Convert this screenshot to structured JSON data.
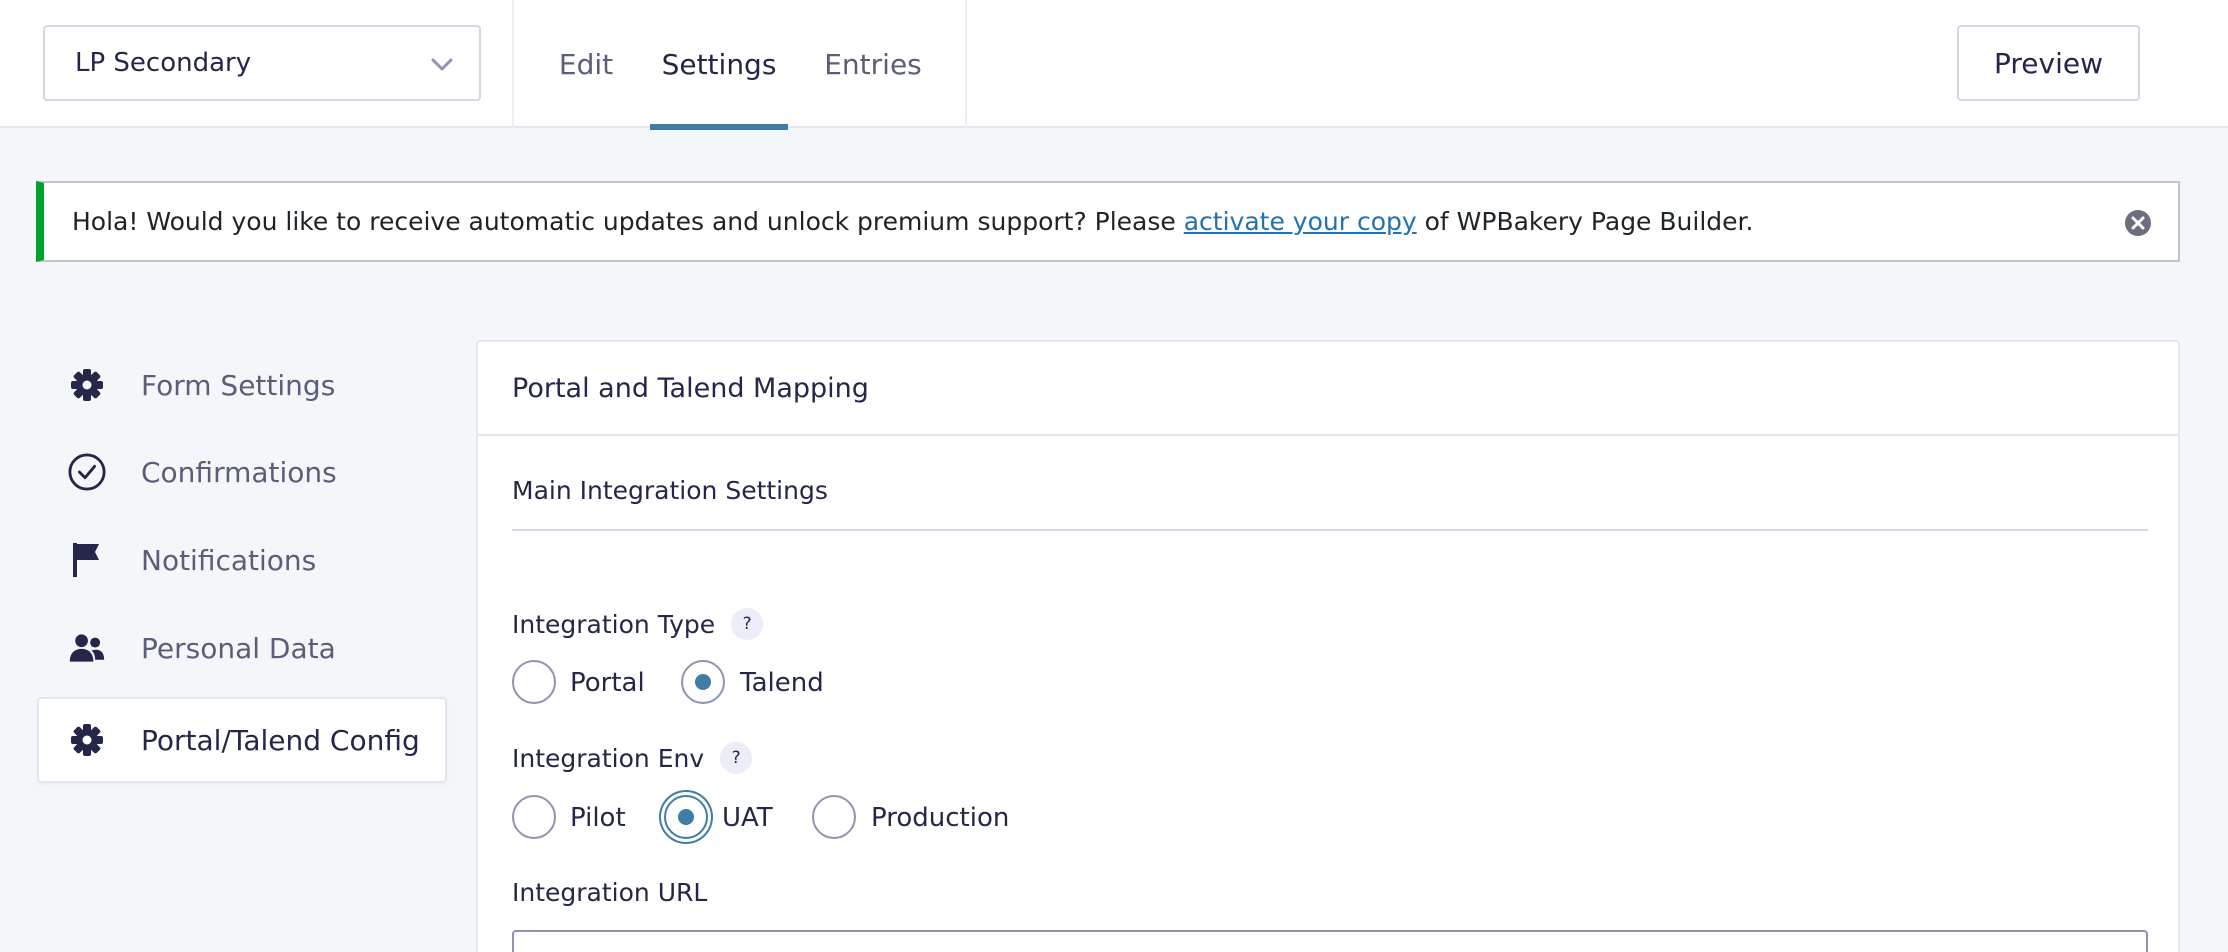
{
  "header": {
    "form_selector": {
      "value": "LP Secondary",
      "icon": "chevron-down-icon"
    },
    "tabs": [
      {
        "label": "Edit",
        "active": false
      },
      {
        "label": "Settings",
        "active": true
      },
      {
        "label": "Entries",
        "active": false
      }
    ],
    "preview_label": "Preview",
    "accent_color": "#3e7da6"
  },
  "notice": {
    "text_before": "Hola! Would you like to receive automatic updates and unlock premium support? Please ",
    "link_text": "activate your copy",
    "text_after": " of WPBakery Page Builder.",
    "border_color": "#00a32a",
    "dismiss_icon": "close-circle-icon"
  },
  "sidebar": {
    "items": [
      {
        "label": "Form Settings",
        "icon": "gear-icon",
        "active": false
      },
      {
        "label": "Confirmations",
        "icon": "check-circle-icon",
        "active": false
      },
      {
        "label": "Notifications",
        "icon": "flag-icon",
        "active": false
      },
      {
        "label": "Personal Data",
        "icon": "users-icon",
        "active": false
      },
      {
        "label": "Portal/Talend Config",
        "icon": "gear-icon",
        "active": true
      }
    ]
  },
  "panel": {
    "title": "Portal and Talend Mapping",
    "section_title": "Main Integration Settings",
    "integration_type": {
      "label": "Integration Type",
      "help": "?",
      "options": [
        "Portal",
        "Talend"
      ],
      "selected": "Talend"
    },
    "integration_env": {
      "label": "Integration Env",
      "help": "?",
      "options": [
        "Pilot",
        "UAT",
        "Production"
      ],
      "selected": "UAT"
    },
    "integration_url": {
      "label": "Integration URL",
      "value": ""
    }
  }
}
